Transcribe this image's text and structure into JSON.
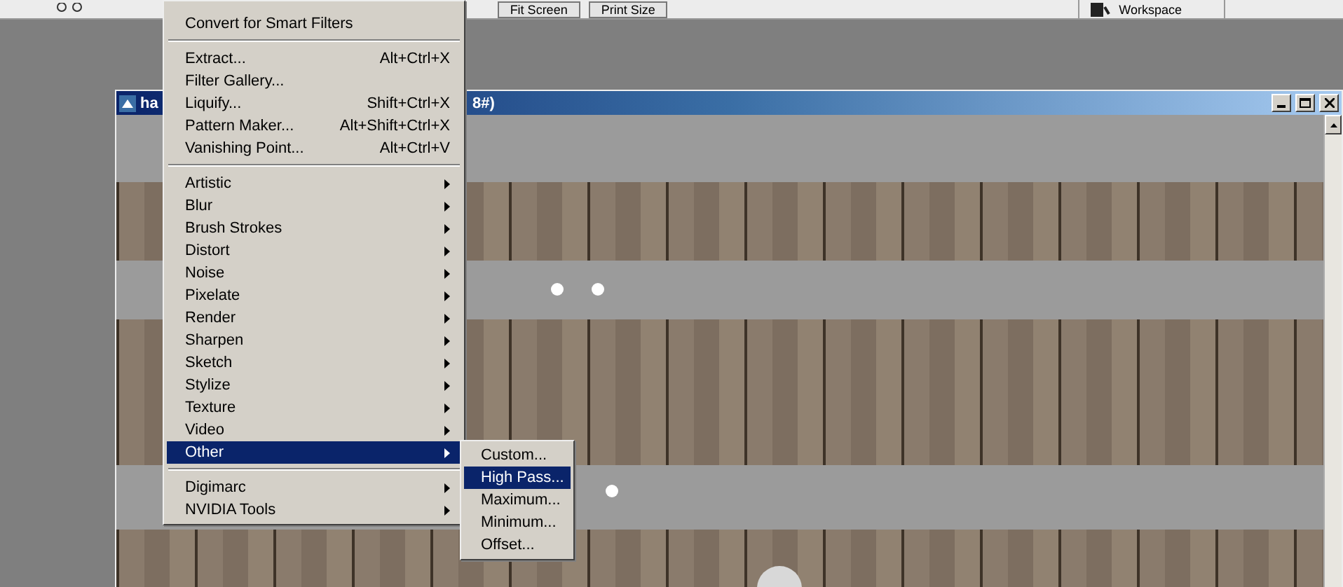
{
  "toolbar": {
    "buttons": [
      "Fit Screen",
      "Print Size"
    ],
    "workspace": "Workspace"
  },
  "document_window": {
    "title_start": "ha",
    "title_end": "8#)"
  },
  "menu": {
    "groups": [
      [
        {
          "label": "Convert for Smart Filters",
          "has_submenu": false,
          "selected": false
        }
      ],
      [
        {
          "label": "Extract...",
          "shortcut": "Alt+Ctrl+X",
          "has_submenu": false,
          "selected": false
        },
        {
          "label": "Filter Gallery...",
          "has_submenu": false,
          "selected": false
        },
        {
          "label": "Liquify...",
          "shortcut": "Shift+Ctrl+X",
          "has_submenu": false,
          "selected": false
        },
        {
          "label": "Pattern Maker...",
          "shortcut": "Alt+Shift+Ctrl+X",
          "has_submenu": false,
          "selected": false
        },
        {
          "label": "Vanishing Point...",
          "shortcut": "Alt+Ctrl+V",
          "has_submenu": false,
          "selected": false
        }
      ],
      [
        {
          "label": "Artistic",
          "has_submenu": true,
          "selected": false
        },
        {
          "label": "Blur",
          "has_submenu": true,
          "selected": false
        },
        {
          "label": "Brush Strokes",
          "has_submenu": true,
          "selected": false
        },
        {
          "label": "Distort",
          "has_submenu": true,
          "selected": false
        },
        {
          "label": "Noise",
          "has_submenu": true,
          "selected": false
        },
        {
          "label": "Pixelate",
          "has_submenu": true,
          "selected": false
        },
        {
          "label": "Render",
          "has_submenu": true,
          "selected": false
        },
        {
          "label": "Sharpen",
          "has_submenu": true,
          "selected": false
        },
        {
          "label": "Sketch",
          "has_submenu": true,
          "selected": false
        },
        {
          "label": "Stylize",
          "has_submenu": true,
          "selected": false
        },
        {
          "label": "Texture",
          "has_submenu": true,
          "selected": false
        },
        {
          "label": "Video",
          "has_submenu": true,
          "selected": false
        },
        {
          "label": "Other",
          "has_submenu": true,
          "selected": true
        }
      ],
      [
        {
          "label": "Digimarc",
          "has_submenu": true,
          "selected": false
        },
        {
          "label": "NVIDIA Tools",
          "has_submenu": true,
          "selected": false
        }
      ]
    ]
  },
  "submenu": {
    "items": [
      {
        "label": "Custom...",
        "selected": false
      },
      {
        "label": "High Pass...",
        "selected": true
      },
      {
        "label": "Maximum...",
        "selected": false
      },
      {
        "label": "Minimum...",
        "selected": false
      },
      {
        "label": "Offset...",
        "selected": false
      }
    ]
  }
}
